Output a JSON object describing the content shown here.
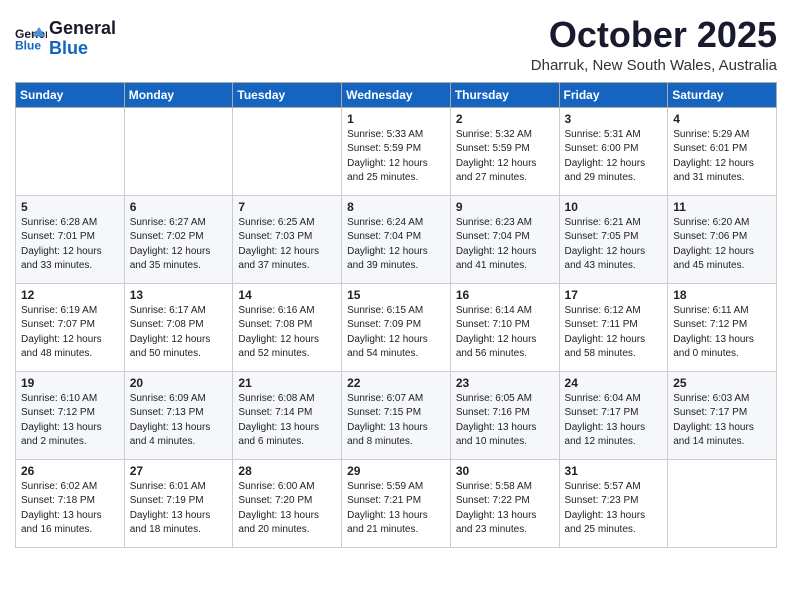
{
  "header": {
    "logo_line1": "General",
    "logo_line2": "Blue",
    "title": "October 2025",
    "subtitle": "Dharruk, New South Wales, Australia"
  },
  "weekdays": [
    "Sunday",
    "Monday",
    "Tuesday",
    "Wednesday",
    "Thursday",
    "Friday",
    "Saturday"
  ],
  "weeks": [
    [
      {
        "day": "",
        "info": ""
      },
      {
        "day": "",
        "info": ""
      },
      {
        "day": "",
        "info": ""
      },
      {
        "day": "1",
        "info": "Sunrise: 5:33 AM\nSunset: 5:59 PM\nDaylight: 12 hours\nand 25 minutes."
      },
      {
        "day": "2",
        "info": "Sunrise: 5:32 AM\nSunset: 5:59 PM\nDaylight: 12 hours\nand 27 minutes."
      },
      {
        "day": "3",
        "info": "Sunrise: 5:31 AM\nSunset: 6:00 PM\nDaylight: 12 hours\nand 29 minutes."
      },
      {
        "day": "4",
        "info": "Sunrise: 5:29 AM\nSunset: 6:01 PM\nDaylight: 12 hours\nand 31 minutes."
      }
    ],
    [
      {
        "day": "5",
        "info": "Sunrise: 6:28 AM\nSunset: 7:01 PM\nDaylight: 12 hours\nand 33 minutes."
      },
      {
        "day": "6",
        "info": "Sunrise: 6:27 AM\nSunset: 7:02 PM\nDaylight: 12 hours\nand 35 minutes."
      },
      {
        "day": "7",
        "info": "Sunrise: 6:25 AM\nSunset: 7:03 PM\nDaylight: 12 hours\nand 37 minutes."
      },
      {
        "day": "8",
        "info": "Sunrise: 6:24 AM\nSunset: 7:04 PM\nDaylight: 12 hours\nand 39 minutes."
      },
      {
        "day": "9",
        "info": "Sunrise: 6:23 AM\nSunset: 7:04 PM\nDaylight: 12 hours\nand 41 minutes."
      },
      {
        "day": "10",
        "info": "Sunrise: 6:21 AM\nSunset: 7:05 PM\nDaylight: 12 hours\nand 43 minutes."
      },
      {
        "day": "11",
        "info": "Sunrise: 6:20 AM\nSunset: 7:06 PM\nDaylight: 12 hours\nand 45 minutes."
      }
    ],
    [
      {
        "day": "12",
        "info": "Sunrise: 6:19 AM\nSunset: 7:07 PM\nDaylight: 12 hours\nand 48 minutes."
      },
      {
        "day": "13",
        "info": "Sunrise: 6:17 AM\nSunset: 7:08 PM\nDaylight: 12 hours\nand 50 minutes."
      },
      {
        "day": "14",
        "info": "Sunrise: 6:16 AM\nSunset: 7:08 PM\nDaylight: 12 hours\nand 52 minutes."
      },
      {
        "day": "15",
        "info": "Sunrise: 6:15 AM\nSunset: 7:09 PM\nDaylight: 12 hours\nand 54 minutes."
      },
      {
        "day": "16",
        "info": "Sunrise: 6:14 AM\nSunset: 7:10 PM\nDaylight: 12 hours\nand 56 minutes."
      },
      {
        "day": "17",
        "info": "Sunrise: 6:12 AM\nSunset: 7:11 PM\nDaylight: 12 hours\nand 58 minutes."
      },
      {
        "day": "18",
        "info": "Sunrise: 6:11 AM\nSunset: 7:12 PM\nDaylight: 13 hours\nand 0 minutes."
      }
    ],
    [
      {
        "day": "19",
        "info": "Sunrise: 6:10 AM\nSunset: 7:12 PM\nDaylight: 13 hours\nand 2 minutes."
      },
      {
        "day": "20",
        "info": "Sunrise: 6:09 AM\nSunset: 7:13 PM\nDaylight: 13 hours\nand 4 minutes."
      },
      {
        "day": "21",
        "info": "Sunrise: 6:08 AM\nSunset: 7:14 PM\nDaylight: 13 hours\nand 6 minutes."
      },
      {
        "day": "22",
        "info": "Sunrise: 6:07 AM\nSunset: 7:15 PM\nDaylight: 13 hours\nand 8 minutes."
      },
      {
        "day": "23",
        "info": "Sunrise: 6:05 AM\nSunset: 7:16 PM\nDaylight: 13 hours\nand 10 minutes."
      },
      {
        "day": "24",
        "info": "Sunrise: 6:04 AM\nSunset: 7:17 PM\nDaylight: 13 hours\nand 12 minutes."
      },
      {
        "day": "25",
        "info": "Sunrise: 6:03 AM\nSunset: 7:17 PM\nDaylight: 13 hours\nand 14 minutes."
      }
    ],
    [
      {
        "day": "26",
        "info": "Sunrise: 6:02 AM\nSunset: 7:18 PM\nDaylight: 13 hours\nand 16 minutes."
      },
      {
        "day": "27",
        "info": "Sunrise: 6:01 AM\nSunset: 7:19 PM\nDaylight: 13 hours\nand 18 minutes."
      },
      {
        "day": "28",
        "info": "Sunrise: 6:00 AM\nSunset: 7:20 PM\nDaylight: 13 hours\nand 20 minutes."
      },
      {
        "day": "29",
        "info": "Sunrise: 5:59 AM\nSunset: 7:21 PM\nDaylight: 13 hours\nand 21 minutes."
      },
      {
        "day": "30",
        "info": "Sunrise: 5:58 AM\nSunset: 7:22 PM\nDaylight: 13 hours\nand 23 minutes."
      },
      {
        "day": "31",
        "info": "Sunrise: 5:57 AM\nSunset: 7:23 PM\nDaylight: 13 hours\nand 25 minutes."
      },
      {
        "day": "",
        "info": ""
      }
    ]
  ]
}
